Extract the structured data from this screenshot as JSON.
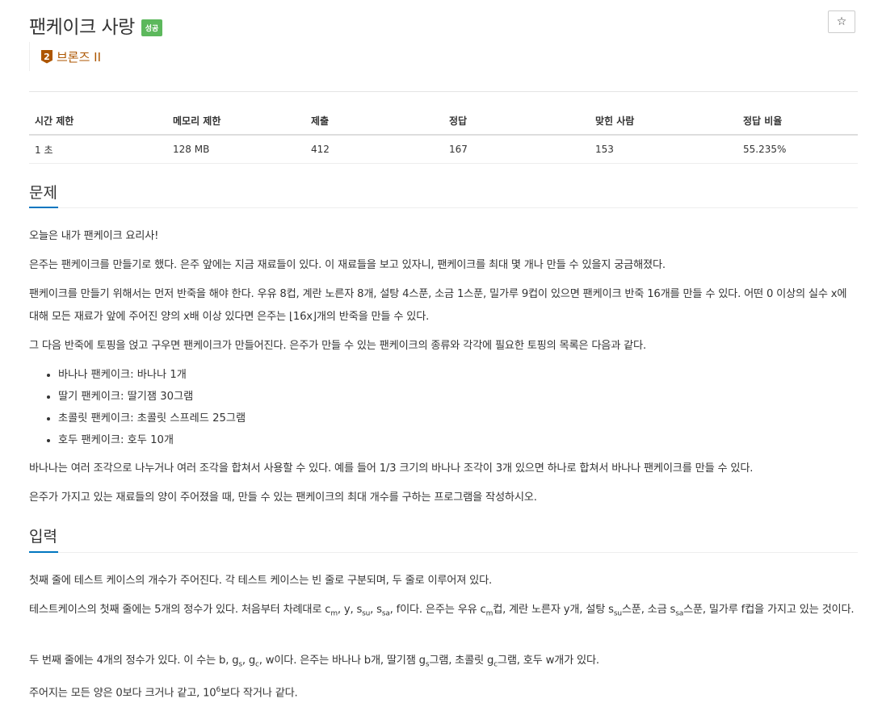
{
  "problem": {
    "title": "팬케이크 사랑",
    "status_badge": "성공",
    "tier_number": "2",
    "tier_label": "브론즈 II",
    "star_icon": "☆"
  },
  "stats": {
    "headers": [
      "시간 제한",
      "메모리 제한",
      "제출",
      "정답",
      "맞힌 사람",
      "정답 비율"
    ],
    "values": [
      "1 초",
      "128 MB",
      "412",
      "167",
      "153",
      "55.235%"
    ]
  },
  "sections": {
    "problem_title": "문제",
    "input_title": "입력"
  },
  "description": {
    "p1": "오늘은 내가 팬케이크 요리사!",
    "p2": "은주는 팬케이크를 만들기로 했다. 은주 앞에는 지금 재료들이 있다. 이 재료들을 보고 있자니, 팬케이크를 최대 몇 개나 만들 수 있을지 궁금해졌다.",
    "p3": "팬케이크를 만들기 위해서는 먼저 반죽을 해야 한다. 우유 8컵, 계란 노른자 8개, 설탕 4스푼, 소금 1스푼, 밀가루 9컵이 있으면 팬케이크 반죽 16개를 만들 수 있다. 어떤 0 이상의 실수 x에 대해 모든 재료가 앞에 주어진 양의 x배 이상 있다면 은주는 ⌊16x⌋개의 반죽을 만들 수 있다.",
    "p4": "그 다음 반죽에 토핑을 얹고 구우면 팬케이크가 만들어진다. 은주가 만들 수 있는 팬케이크의 종류와 각각에 필요한 토핑의 목록은 다음과 같다.",
    "toppings": [
      "바나나 팬케이크: 바나나 1개",
      "딸기 팬케이크: 딸기잼 30그램",
      "초콜릿 팬케이크: 초콜릿 스프레드 25그램",
      "호두 팬케이크: 호두 10개"
    ],
    "p5": "바나나는 여러 조각으로 나누거나 여러 조각을 합쳐서 사용할 수 있다. 예를 들어 1/3 크기의 바나나 조각이 3개 있으면 하나로 합쳐서 바나나 팬케이크를 만들 수 있다.",
    "p6": "은주가 가지고 있는 재료들의 양이 주어졌을 때, 만들 수 있는 팬케이크의 최대 개수를 구하는 프로그램을 작성하시오."
  },
  "input": {
    "p1": "첫째 줄에 테스트 케이스의 개수가 주어진다. 각 테스트 케이스는 빈 줄로 구분되며, 두 줄로 이루어져 있다.",
    "p2_a": "테스트케이스의 첫째 줄에는 5개의 정수가 있다. 처음부터 차례대로 c",
    "p2_sub_m": "m",
    "p2_b": ", y, s",
    "p2_sub_su": "su",
    "p2_c": ", s",
    "p2_sub_sa": "sa",
    "p2_d": ", f이다. 은주는 우유 c",
    "p2_e": "컵, 계란 노른자 y개, 설탕 s",
    "p2_f": "스푼, 소금 s",
    "p2_g": "스푼, 밀가루 f컵을 가지고 있는 것이다.",
    "p3_a": "두 번째 줄에는 4개의 정수가 있다. 이 수는 b, g",
    "p3_sub_s": "s",
    "p3_b": ", g",
    "p3_sub_c": "c",
    "p3_c": ", w이다. 은주는 바나나 b개, 딸기잼 g",
    "p3_d": "그램, 초콜릿 g",
    "p3_e": "그램, 호두 w개가 있다.",
    "p4_a": "주어지는 모든 양은 0보다 크거나 같고, 10",
    "p4_sup": "6",
    "p4_b": "보다 작거나 같다."
  }
}
